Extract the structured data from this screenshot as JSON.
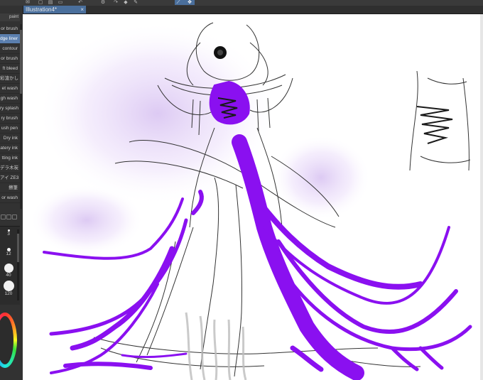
{
  "toolbar": {
    "icons": [
      "mail-icon",
      "new-icon",
      "open-icon",
      "save-icon",
      "undo-icon",
      "redo-icon",
      "settings-icon",
      "fill-icon",
      "pen-icon",
      "selection-icon",
      "lasso-icon",
      "move-icon"
    ]
  },
  "document": {
    "tab_label": "Illustration4*",
    "close_glyph": "×"
  },
  "brush_panel": {
    "header": "paint",
    "items": [
      {
        "label": "or brush",
        "active": false
      },
      {
        "label": "dge liner",
        "active": true
      },
      {
        "label": "contour",
        "active": false
      },
      {
        "label": "or brush",
        "active": false
      },
      {
        "label": "ft bleed",
        "active": false
      },
      {
        "label": "彩渲かし",
        "active": false
      },
      {
        "label": "et wash",
        "active": false
      },
      {
        "label": "gh wash",
        "active": false
      },
      {
        "label": "ry splash",
        "active": false
      },
      {
        "label": "ry brush",
        "active": false
      },
      {
        "label": "ush pen",
        "active": false
      },
      {
        "label": "Dry ink",
        "active": false
      },
      {
        "label": "atery ink",
        "active": false
      },
      {
        "label": "tting ink",
        "active": false
      },
      {
        "label": "デラ木炭",
        "active": false
      },
      {
        "label": "アイ ZE3",
        "active": false
      },
      {
        "label": "擦筆",
        "active": false
      },
      {
        "label": "or wash",
        "active": false
      }
    ]
  },
  "brush_sizes": [
    "3",
    "12",
    "40",
    "120"
  ],
  "colors": {
    "accent": "#4a6f9c",
    "stroke_purple": "#8a10f0",
    "sketch_line": "#333333",
    "glow": "#e7d6f7"
  }
}
